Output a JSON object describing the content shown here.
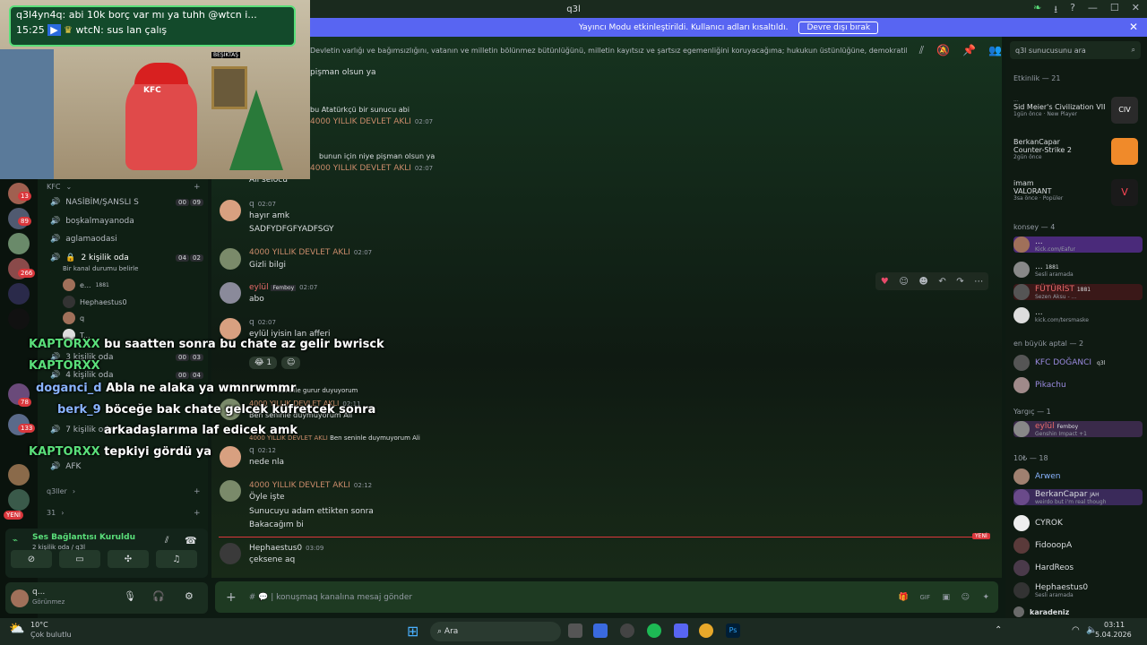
{
  "window": {
    "title": "q3l"
  },
  "streamer_mode": {
    "text": "Yayıncı Modu etkinleştirildi. Kullanıcı adları kısaltıldı.",
    "button": "Devre dışı bırak"
  },
  "topic": "Devletin varlığı ve bağımsızlığını, vatanın ve milletin bölünmez bütünlüğünü, milletin kayıtsız ve şartsız egemenliğini koruyacağıma; hukukun üstünlüğüne, demokratik ve laik Cumhuriyete ve...",
  "search_placeholder": "q3l sunucusunu ara",
  "stream": {
    "chat_line1": "q3l4yn4q: abi 10k borç var mı ya tuhh @wtcn i...",
    "chat_time": "15:25",
    "chat_line2": "wtcN: sus lan çalış",
    "scene_label1": "KFC",
    "scene_label2": "BEŞİKTAŞ"
  },
  "overlay": [
    {
      "name": "KAPTORXX",
      "text": "bu saatten sonra bu chate az gelir bwrisck"
    },
    {
      "name": "KAPTORXX",
      "text": ""
    },
    {
      "name": "doganci_d",
      "text": "Abla ne alaka ya wmnrwmmr"
    },
    {
      "name": "berk_9",
      "text": "böceğe bak chate gelcek küfretcek sonra"
    },
    {
      "name": "",
      "text": "arkadaşlarıma laf edicek amk"
    },
    {
      "name": "KAPTORXX",
      "text": "tepkiyi gördü ya"
    }
  ],
  "channels": {
    "category": "KFC",
    "items": [
      {
        "label": "NASİBİM/ŞANSLI S",
        "count_a": "00",
        "count_b": "09"
      },
      {
        "label": "boşkalmayanoda"
      },
      {
        "label": "aglamaodasi"
      },
      {
        "label": "2 kişilik oda",
        "count_a": "04",
        "count_b": "02",
        "status": "Bir kanal durumu belirle"
      },
      {
        "label": "3 kişilik oda",
        "count_a": "00",
        "count_b": "03"
      },
      {
        "label": "4 kişilik oda",
        "count_a": "00",
        "count_b": "04"
      },
      {
        "label": "7 kişilik oda"
      },
      {
        "label": "AFK"
      }
    ],
    "voice_users": [
      {
        "name": "e...",
        "badge": "1881"
      },
      {
        "name": "Hephaestus0"
      },
      {
        "name": "q"
      },
      {
        "name": "T..."
      }
    ],
    "cat2": "q3ller",
    "cat3": "31",
    "new_label": "YENİ",
    "server_badges": [
      "13",
      "89",
      "266",
      "78",
      "133"
    ]
  },
  "voice": {
    "status": "Ses Bağlantısı Kuruldu",
    "channel": "2 kişilik oda / q3l"
  },
  "user": {
    "name": "q...",
    "status": "Görünmez"
  },
  "messages": [
    {
      "author": "",
      "text": "pişman olsun ya"
    },
    {
      "author": "",
      "text": "bu Atatürkçü bir sunucu abi"
    },
    {
      "author": "4000 YILLIK DEVLET AKLI",
      "time": "02:07",
      "text": ""
    },
    {
      "author": "",
      "text": "bunun için niye pişman olsun ya"
    },
    {
      "author": "4000 YILLIK DEVLET AKLI",
      "time": "02:07",
      "text": "Ali selocu"
    },
    {
      "author": "q",
      "time": "02:07",
      "text": "hayır amk",
      "text2": "SADFYDFGFYADFSGY"
    },
    {
      "author": "4000 YILLIK DEVLET AKLI",
      "time": "02:07",
      "text": "Gizli bilgi"
    },
    {
      "author": "eylül",
      "tag": "Femboy",
      "time": "02:07",
      "text": "abo"
    },
    {
      "author": "q",
      "time": "02:07",
      "text": "eylül iyisin lan afferi",
      "reaction": "1"
    },
    {
      "author": "",
      "text": "Seninle gurur duyuyorum"
    },
    {
      "author": "4000 YILLIK DEVLET AKLI",
      "time": "02:11",
      "text": "Ben seninle duymuyorum Ali"
    },
    {
      "author": "4000 YILLIK DEVLET AKLI",
      "text": "Ben seninle duymuyorum Ali"
    },
    {
      "author": "q",
      "time": "02:12",
      "text": "nede nla"
    },
    {
      "author": "4000 YILLIK DEVLET AKLI",
      "time": "02:12",
      "text": "Öyle işte",
      "text2": "Sunucuyu adam ettikten sonra",
      "text3": "Bakacağım bi"
    },
    {
      "author": "Hephaestus0",
      "time": "03:09",
      "text": "çeksene aq"
    }
  ],
  "new_badge": "YENİ",
  "composer_placeholder": "# 💬 | konuşmaq kanalına mesaj gönder",
  "members": {
    "activity_header": "Etkinlik — 21",
    "activities": [
      {
        "user": "...",
        "game": "Sid Meier's Civilization VII",
        "sub": "1gün önce · New Player"
      },
      {
        "user": "BerkanCapar",
        "game": "Counter-Strike 2",
        "sub": "2gün önce"
      },
      {
        "user": "imam",
        "game": "VALORANT",
        "sub": "3sa önce · Popüler"
      }
    ],
    "groups": [
      {
        "header": "konsey — 4",
        "list": [
          {
            "name": "...",
            "sub": "Kick.com/Eafur"
          },
          {
            "name": "...",
            "badge": "1881",
            "sub": "Sesli aramada"
          },
          {
            "name": "FÜTÜRİST",
            "badge": "1881",
            "sub": "Sezen Aksu - ..."
          },
          {
            "name": "...",
            "sub": "kick.com/tersmaske"
          }
        ]
      },
      {
        "header": "en büyük aptal — 2",
        "list": [
          {
            "name": "KFC DOĞANCI",
            "badge": "q3l"
          },
          {
            "name": "Pikachu"
          }
        ]
      },
      {
        "header": "Yargıç — 1",
        "list": [
          {
            "name": "eylül",
            "badge": "Femboy",
            "sub": "Genshin Impact +1"
          }
        ]
      },
      {
        "header": "10₺ — 18",
        "list": [
          {
            "name": "Arwen"
          },
          {
            "name": "BerkanCapar",
            "badge": "JAH",
            "sub": "weirdo but i'm real though"
          },
          {
            "name": "CYROK"
          },
          {
            "name": "FidooopA"
          },
          {
            "name": "HardReos"
          },
          {
            "name": "Hephaestus0",
            "sub": "Sesli aramada"
          },
          {
            "name": "karadeniz"
          }
        ]
      }
    ]
  },
  "taskbar": {
    "temp": "10°C",
    "weather": "Çok bulutlu",
    "search": "Ara",
    "time": "03:11",
    "date": "5.04.2026"
  }
}
